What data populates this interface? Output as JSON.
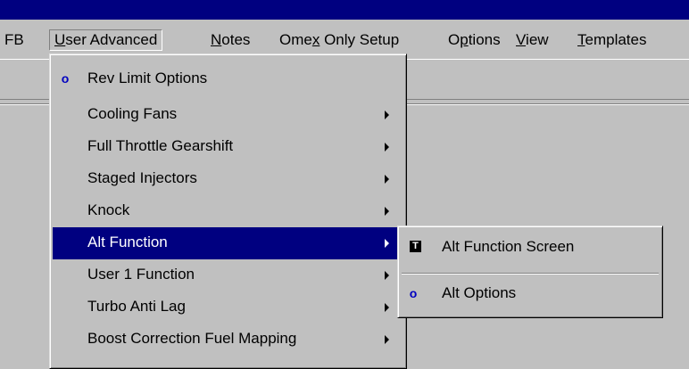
{
  "menubar": {
    "items": [
      {
        "label": "FB"
      },
      {
        "label": "User Advanced",
        "mnemonic": "U"
      },
      {
        "label": "Notes",
        "mnemonic": "N"
      },
      {
        "label": "Omex Only Setup",
        "mnemonic": "x"
      },
      {
        "label": "Options",
        "mnemonic": "p"
      },
      {
        "label": "View",
        "mnemonic": "V"
      },
      {
        "label": "Templates",
        "mnemonic": "T"
      }
    ]
  },
  "user_advanced_menu": {
    "items": [
      {
        "label": "Rev Limit Options",
        "icon": "o-icon",
        "has_submenu": false
      },
      {
        "label": "Cooling Fans",
        "has_submenu": true
      },
      {
        "label": "Full Throttle Gearshift",
        "has_submenu": true
      },
      {
        "label": "Staged Injectors",
        "has_submenu": true
      },
      {
        "label": "Knock",
        "has_submenu": true
      },
      {
        "label": "Alt Function",
        "has_submenu": true,
        "highlighted": true
      },
      {
        "label": "User 1 Function",
        "has_submenu": true
      },
      {
        "label": "Turbo Anti Lag",
        "has_submenu": true
      },
      {
        "label": "Boost Correction Fuel Mapping",
        "has_submenu": true
      }
    ]
  },
  "alt_function_submenu": {
    "items": [
      {
        "label": "Alt Function Screen",
        "icon": "t-icon"
      },
      {
        "label": "Alt Options",
        "icon": "o-icon"
      }
    ]
  },
  "colors": {
    "titlebar": "#000080",
    "highlight": "#000080",
    "face": "#c0c0c0",
    "icon_blue": "#0000c0"
  }
}
